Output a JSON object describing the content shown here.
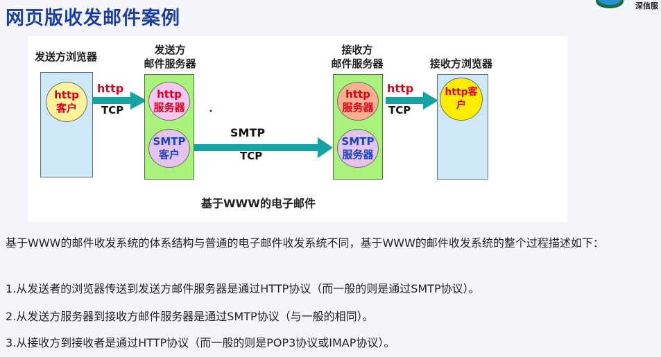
{
  "page": {
    "title": "网页版收发邮件案例",
    "logo_text": "深信服"
  },
  "diagram": {
    "sender_browser_label": "发送方浏览器",
    "sender_server_label_1": "发送方",
    "sender_server_label_2": "邮件服务器",
    "receiver_server_label_1": "接收方",
    "receiver_server_label_2": "邮件服务器",
    "receiver_browser_label": "接收方浏览器",
    "http_client_line1": "http",
    "http_client_line2": "客户",
    "http_server_line1": "http",
    "http_server_line2": "服务器",
    "smtp_client_line1": "SMTP",
    "smtp_client_line2": "客户",
    "smtp_server_line1": "SMTP",
    "smtp_server_line2": "服务器",
    "http_server2_line1": "http",
    "http_server2_line2": "服务器",
    "http_client2": "http客户",
    "arrow1_top": "http",
    "arrow1_bottom": "TCP",
    "arrow2_top": "SMTP",
    "arrow2_bottom": "TCP",
    "arrow3_top": "http",
    "arrow3_bottom": "TCP",
    "caption": "基于WWW的电子邮件"
  },
  "body": {
    "intro": "基于WWW的邮件收发系统的体系结构与普通的电子邮件收发系统不同，基于WWW的邮件收发系统的整个过程描述如下：",
    "step1": "1.从发送者的浏览器传送到发送方邮件服务器是通过HTTP协议（而一般的则是通过SMTP协议）。",
    "step2": "2.从发送方服务器到接收方邮件服务器是通过SMTP协议（与一般的相同）。",
    "step3": "3.从接收方到接收者是通过HTTP协议（而一般的则是POP3协议或IMAP协议）。"
  },
  "colors": {
    "title": "#1d3fa3",
    "arrow": "#16a3a3",
    "browser_box": "#cde8f6",
    "server_box": "#a9f27b"
  }
}
